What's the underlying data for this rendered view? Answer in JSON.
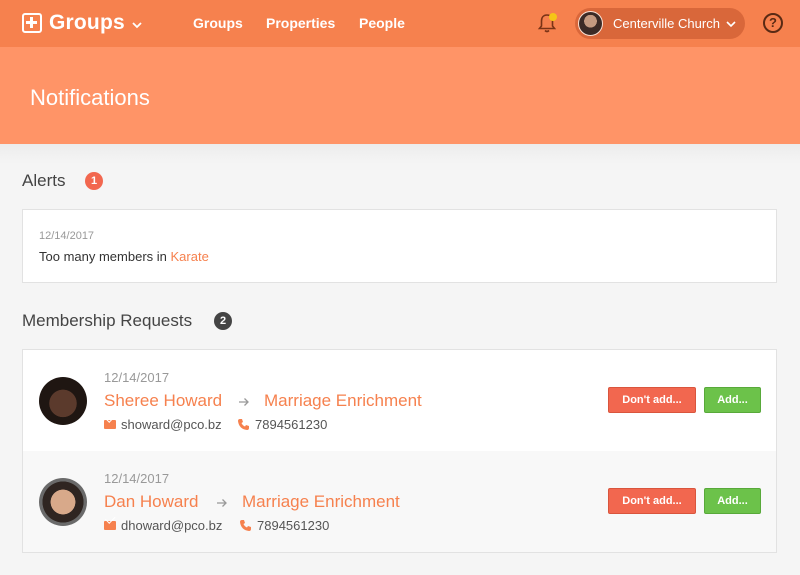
{
  "app": {
    "brand": "Groups",
    "nav": [
      "Groups",
      "Properties",
      "People"
    ],
    "org_name": "Centerville Church",
    "help_symbol": "?"
  },
  "page": {
    "title": "Notifications"
  },
  "alerts": {
    "title": "Alerts",
    "count": "1",
    "items": [
      {
        "date": "12/14/2017",
        "text_prefix": "Too many members in ",
        "link": "Karate"
      }
    ]
  },
  "requests": {
    "title": "Membership Requests",
    "count": "2",
    "items": [
      {
        "date": "12/14/2017",
        "name": "Sheree Howard",
        "group": "Marriage Enrichment",
        "email": "showard@pco.bz",
        "phone": "7894561230",
        "decline_label": "Don't add...",
        "accept_label": "Add..."
      },
      {
        "date": "12/14/2017",
        "name": "Dan Howard",
        "group": "Marriage Enrichment",
        "email": "dhoward@pco.bz",
        "phone": "7894561230",
        "decline_label": "Don't add...",
        "accept_label": "Add..."
      }
    ]
  },
  "colors": {
    "accent": "#f6814e",
    "header": "#ff9467",
    "decline": "#f2674f",
    "accept": "#6cc24a"
  }
}
